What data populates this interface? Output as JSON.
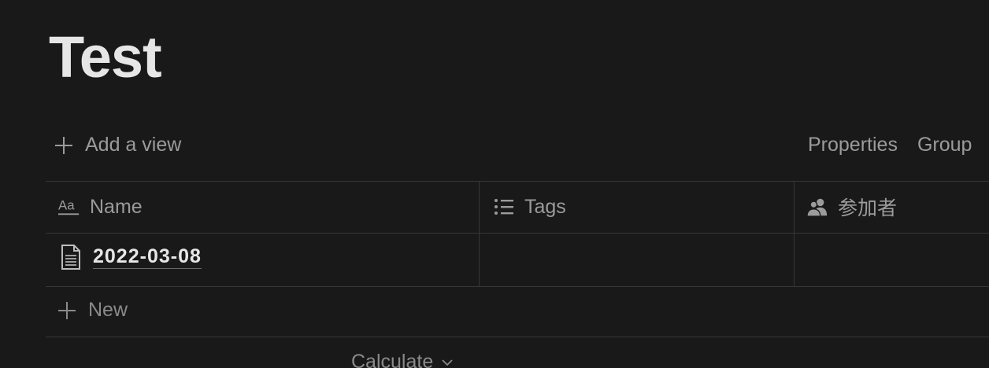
{
  "page": {
    "title": "Test"
  },
  "viewbar": {
    "add_view_label": "Add a view",
    "properties_label": "Properties",
    "group_label": "Group"
  },
  "table": {
    "columns": [
      {
        "label": "Name",
        "icon": "text-property-icon"
      },
      {
        "label": "Tags",
        "icon": "list-icon"
      },
      {
        "label": "参加者",
        "icon": "person-icon"
      }
    ],
    "rows": [
      {
        "name": "2022-03-08",
        "icon": "page-icon"
      }
    ],
    "new_label": "New",
    "calculate_label": "Calculate"
  },
  "colors": {
    "background": "#191919",
    "border": "#373737",
    "muted_text": "#9b9b9b",
    "title_text": "#e6e6e6"
  }
}
